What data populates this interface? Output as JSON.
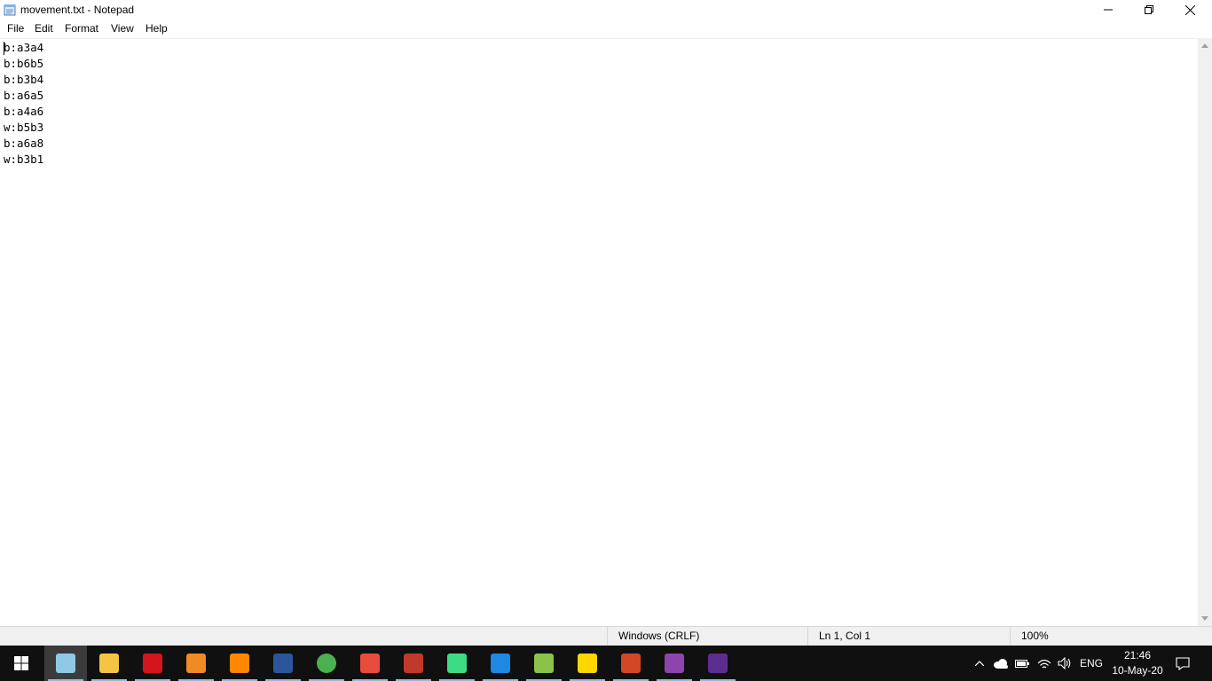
{
  "window": {
    "title": "movement.txt - Notepad",
    "minimize_icon": "minimize-icon",
    "restore_icon": "restore-icon",
    "close_icon": "close-icon"
  },
  "menu": {
    "items": [
      "File",
      "Edit",
      "Format",
      "View",
      "Help"
    ]
  },
  "editor": {
    "lines": [
      "b:a3a4",
      "b:b6b5",
      "b:b3b4",
      "b:a6a5",
      "b:a4a6",
      "w:b5b3",
      "b:a6a8",
      "w:b3b1"
    ]
  },
  "status": {
    "encoding": "Windows (CRLF)",
    "position": "Ln 1, Col 1",
    "zoom": "100%"
  },
  "taskbar": {
    "apps": [
      {
        "name": "notepad-app",
        "icon": "notepad-icon",
        "color": "#8ecae6",
        "active": true
      },
      {
        "name": "file-explorer-app",
        "icon": "folder-icon",
        "color": "#f4c542",
        "active": false
      },
      {
        "name": "acrobat-app",
        "icon": "acrobat-icon",
        "color": "#d4161c",
        "active": false
      },
      {
        "name": "sublime-text-app",
        "icon": "sublime-icon",
        "color": "#f08a24",
        "active": false
      },
      {
        "name": "vlc-app",
        "icon": "vlc-cone-icon",
        "color": "#ff8800",
        "active": false
      },
      {
        "name": "word-app",
        "icon": "word-icon",
        "color": "#2b579a",
        "active": false
      },
      {
        "name": "chrome-app",
        "icon": "chrome-icon",
        "color": "#4caf50",
        "active": false
      },
      {
        "name": "snipping-tool-app",
        "icon": "snipping-icon",
        "color": "#e74c3c",
        "active": false
      },
      {
        "name": "pdf-editor-app",
        "icon": "pdf-editor-icon",
        "color": "#c0392b",
        "active": false
      },
      {
        "name": "android-studio-app",
        "icon": "android-studio-icon",
        "color": "#3ddc84",
        "active": false
      },
      {
        "name": "vscode-app",
        "icon": "vscode-icon",
        "color": "#1e88e5",
        "active": false
      },
      {
        "name": "cube-app",
        "icon": "cube-icon",
        "color": "#8bc34a",
        "active": false
      },
      {
        "name": "sticky-notes-app",
        "icon": "sticky-notes-icon",
        "color": "#ffd600",
        "active": false
      },
      {
        "name": "powerpoint-app",
        "icon": "powerpoint-icon",
        "color": "#d24726",
        "active": false
      },
      {
        "name": "visual-studio-app",
        "icon": "visual-studio-icon",
        "color": "#8e44ad",
        "active": false
      },
      {
        "name": "terminal-app",
        "icon": "terminal-icon",
        "color": "#5c2d91",
        "active": false
      }
    ],
    "language": "ENG",
    "time": "21:46",
    "date": "10-May-20"
  }
}
